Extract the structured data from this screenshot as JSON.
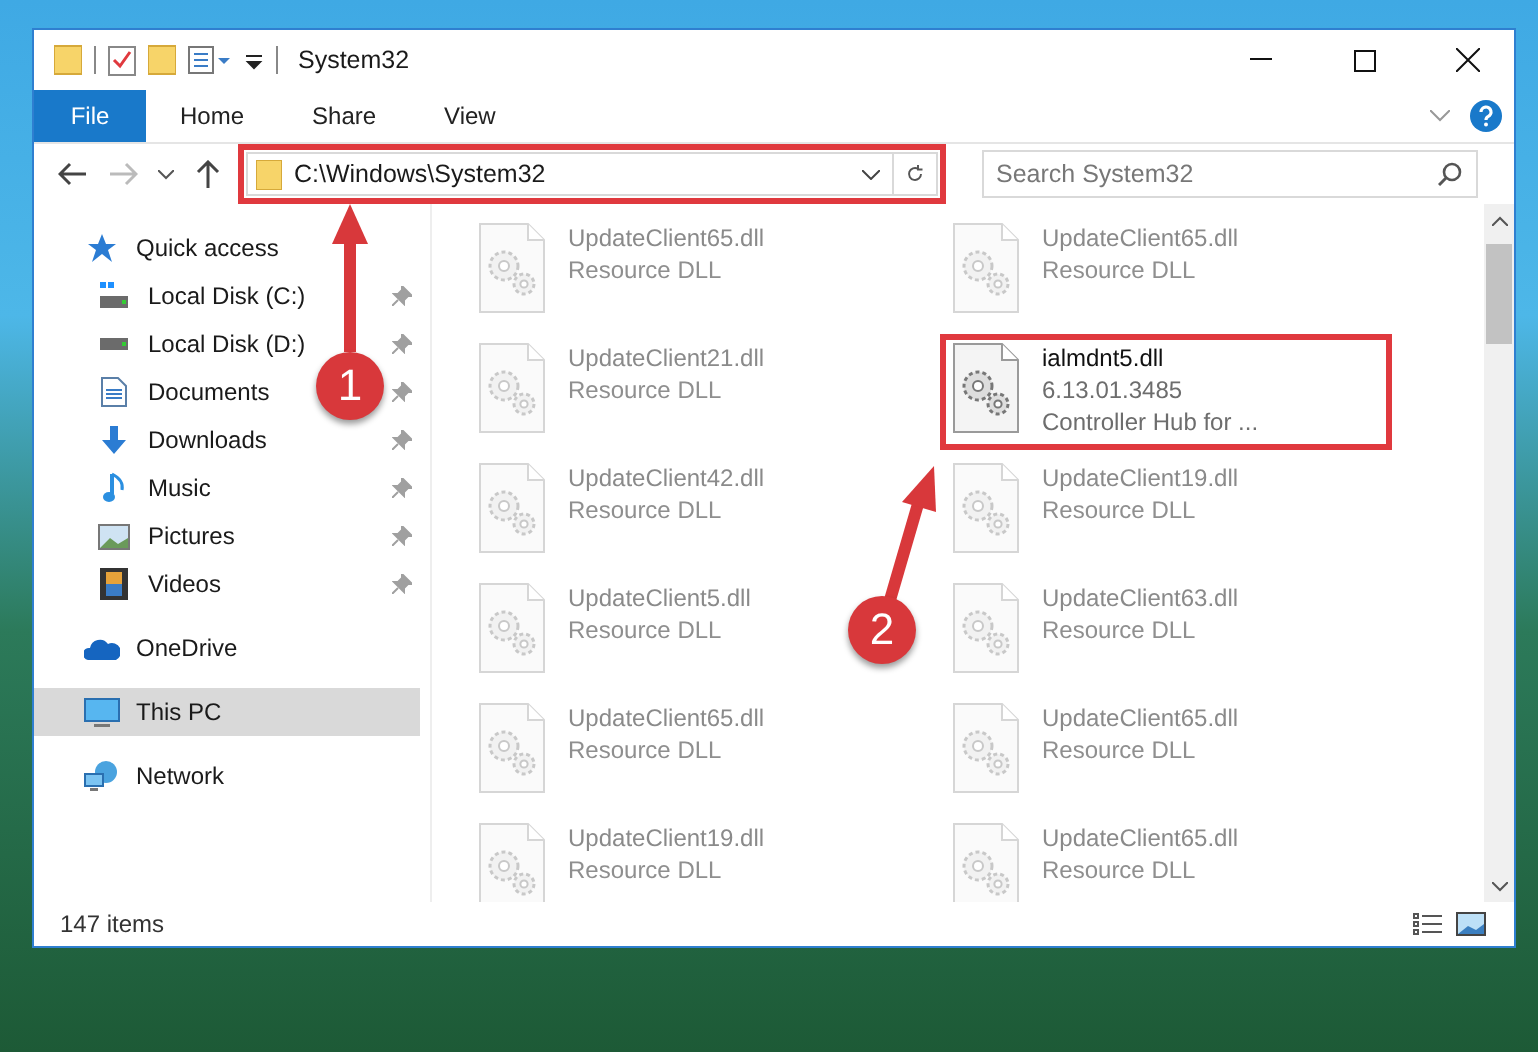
{
  "window": {
    "title": "System32"
  },
  "ribbon": {
    "tabs": [
      {
        "label": "File",
        "selected": true
      },
      {
        "label": "Home",
        "selected": false
      },
      {
        "label": "Share",
        "selected": false
      },
      {
        "label": "View",
        "selected": false
      }
    ]
  },
  "address_bar": {
    "value": "C:\\Windows\\System32",
    "highlighted": true
  },
  "search": {
    "placeholder": "Search System32"
  },
  "sidebar": {
    "items": [
      {
        "label": "Quick access",
        "selected": false,
        "children": [
          {
            "label": "Local Disk (C:)",
            "pinned": true
          },
          {
            "label": "Local Disk (D:)",
            "pinned": true
          },
          {
            "label": "Documents",
            "pinned": true
          },
          {
            "label": "Downloads",
            "pinned": true
          },
          {
            "label": "Music",
            "pinned": true
          },
          {
            "label": "Pictures",
            "pinned": true
          },
          {
            "label": "Videos",
            "pinned": true
          }
        ]
      },
      {
        "label": "OneDrive",
        "selected": false
      },
      {
        "label": "This PC",
        "selected": true
      },
      {
        "label": "Network",
        "selected": false
      }
    ]
  },
  "files": [
    {
      "name": "UpdateClient65.dll",
      "lines": [
        "Resource DLL"
      ],
      "faded": true,
      "highlighted": false
    },
    {
      "name": "UpdateClient65.dll",
      "lines": [
        "Resource DLL"
      ],
      "faded": true,
      "highlighted": false
    },
    {
      "name": "UpdateClient21.dll",
      "lines": [
        "Resource DLL"
      ],
      "faded": true,
      "highlighted": false
    },
    {
      "name": "ialmdnt5.dll",
      "lines": [
        "6.13.01.3485",
        "Controller Hub for ..."
      ],
      "faded": false,
      "highlighted": true
    },
    {
      "name": "UpdateClient42.dll",
      "lines": [
        "Resource DLL"
      ],
      "faded": true,
      "highlighted": false
    },
    {
      "name": "UpdateClient19.dll",
      "lines": [
        "Resource DLL"
      ],
      "faded": true,
      "highlighted": false
    },
    {
      "name": "UpdateClient5.dll",
      "lines": [
        "Resource DLL"
      ],
      "faded": true,
      "highlighted": false
    },
    {
      "name": "UpdateClient63.dll",
      "lines": [
        "Resource DLL"
      ],
      "faded": true,
      "highlighted": false
    },
    {
      "name": "UpdateClient65.dll",
      "lines": [
        "Resource DLL"
      ],
      "faded": true,
      "highlighted": false
    },
    {
      "name": "UpdateClient65.dll",
      "lines": [
        "Resource DLL"
      ],
      "faded": true,
      "highlighted": false
    },
    {
      "name": "UpdateClient19.dll",
      "lines": [
        "Resource DLL"
      ],
      "faded": true,
      "highlighted": false
    },
    {
      "name": "UpdateClient65.dll",
      "lines": [
        "Resource DLL"
      ],
      "faded": true,
      "highlighted": false
    }
  ],
  "status_bar": {
    "item_count": "147 items"
  },
  "annotations": [
    {
      "label": "1"
    },
    {
      "label": "2"
    }
  ]
}
